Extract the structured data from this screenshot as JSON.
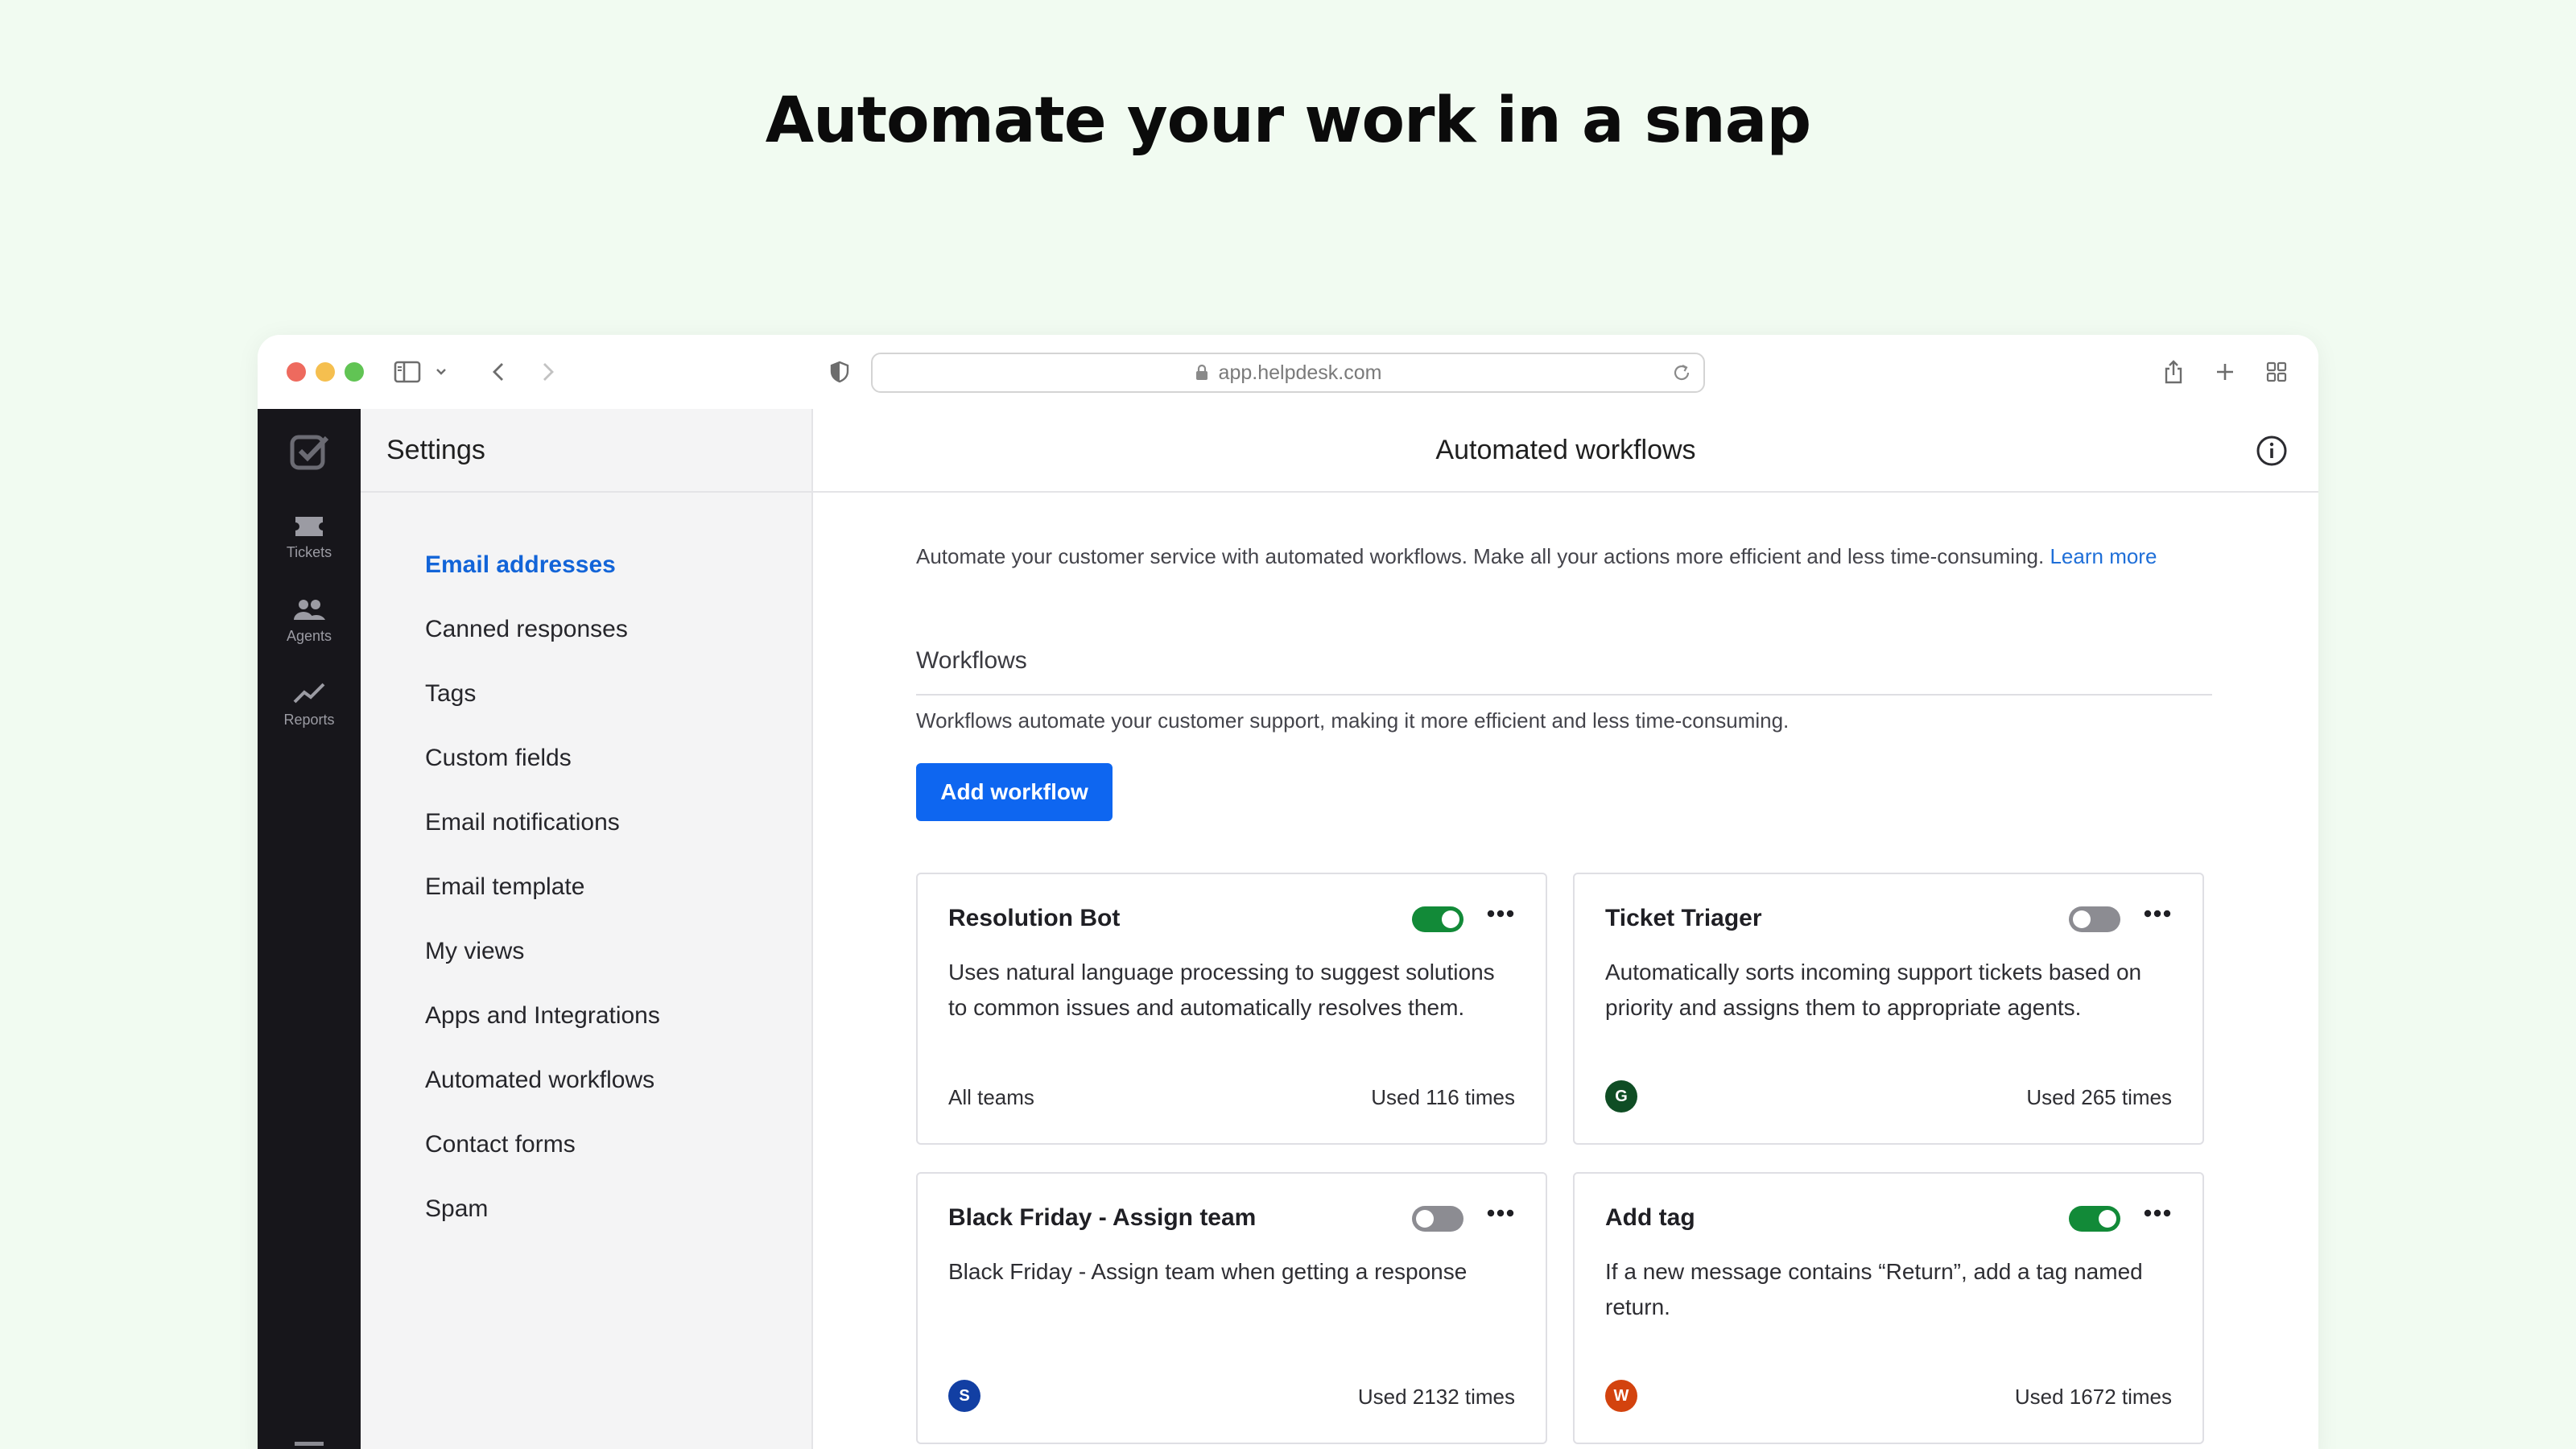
{
  "headline": "Automate your work in a snap",
  "browser": {
    "url": "app.helpdesk.com"
  },
  "rail": {
    "items": [
      {
        "label": "Tickets",
        "icon": "ticket-icon"
      },
      {
        "label": "Agents",
        "icon": "agents-icon"
      },
      {
        "label": "Reports",
        "icon": "reports-icon"
      }
    ]
  },
  "settings": {
    "title": "Settings",
    "menu": [
      "Email addresses",
      "Canned responses",
      "Tags",
      "Custom fields",
      "Email notifications",
      "Email template",
      "My views",
      "Apps and Integrations",
      "Automated workflows",
      "Contact forms",
      "Spam"
    ],
    "active_index": 0
  },
  "main": {
    "title": "Automated workflows",
    "intro": "Automate your customer service with automated workflows. Make all your actions more efficient and less time-consuming.",
    "learn_more": "Learn more",
    "section_title": "Workflows",
    "section_desc": "Workflows automate your customer support, making it more efficient and less time-consuming.",
    "add_button": "Add workflow"
  },
  "workflows": [
    {
      "title": "Resolution Bot",
      "enabled": true,
      "description": "Uses natural language processing to suggest solutions to common issues and automatically resolves them.",
      "owner_text": "All teams",
      "usage": "Used 116 times"
    },
    {
      "title": "Ticket Triager",
      "enabled": false,
      "description": "Automatically sorts incoming support tickets based on priority and assigns them to appropriate agents.",
      "avatar": "G",
      "avatar_color": "#0f4d24",
      "usage": "Used 265 times"
    },
    {
      "title": "Black Friday - Assign team",
      "enabled": false,
      "description": "Black Friday - Assign team when getting a response",
      "avatar": "S",
      "avatar_color": "#123fa3",
      "usage": "Used 2132 times"
    },
    {
      "title": "Add tag",
      "enabled": true,
      "description": "If a new message contains “Return”, add a tag named return.",
      "avatar": "W",
      "avatar_color": "#d3430e",
      "usage": "Used 1672 times"
    }
  ],
  "colors": {
    "accent": "#0e66f0",
    "link": "#1f6fd8",
    "toggle_on": "#128a38",
    "toggle_off": "#8c8c92",
    "rail_bg": "#17161b",
    "page_bg": "#f1fbf1"
  }
}
